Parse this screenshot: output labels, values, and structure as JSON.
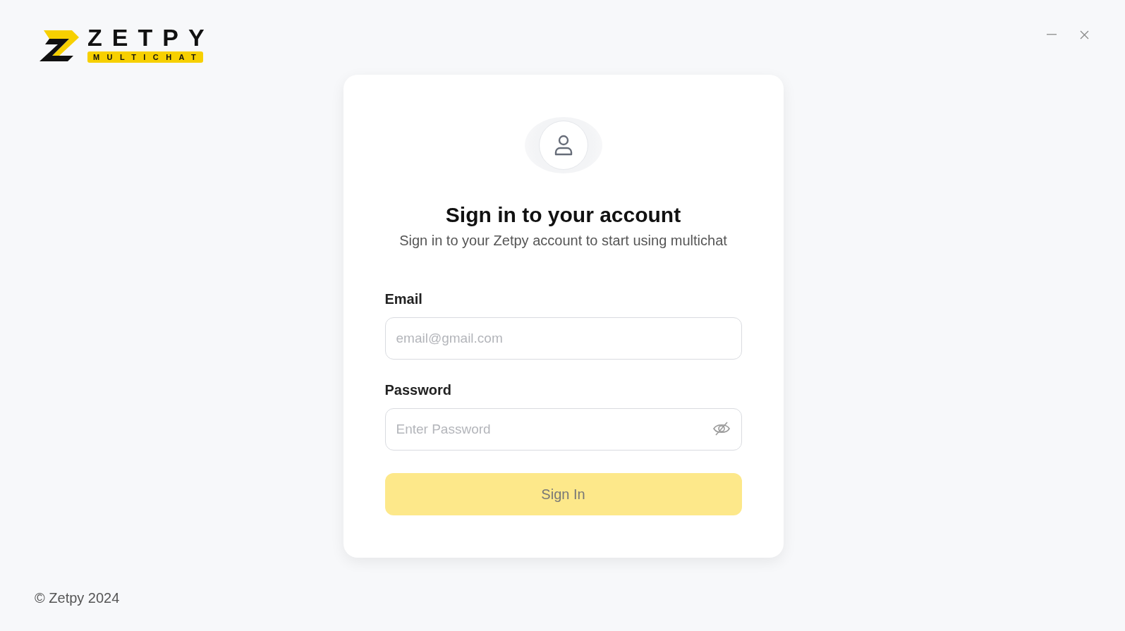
{
  "logo": {
    "title": "ZETPY",
    "subtitle": "MULTICHAT"
  },
  "window_controls": [
    {
      "kind": "minimize"
    },
    {
      "kind": "close"
    }
  ],
  "card": {
    "title": "Sign in to your account",
    "subtitle": "Sign in to your Zetpy account to start using multichat",
    "fields": [
      {
        "kind": "email",
        "label": "Email",
        "placeholder": "email@gmail.com"
      },
      {
        "kind": "password",
        "label": "Password",
        "placeholder": "Enter Password",
        "revealed": false
      }
    ],
    "submit": {
      "label": "Sign In",
      "disabled": true
    }
  },
  "footer": "© Zetpy 2024"
}
